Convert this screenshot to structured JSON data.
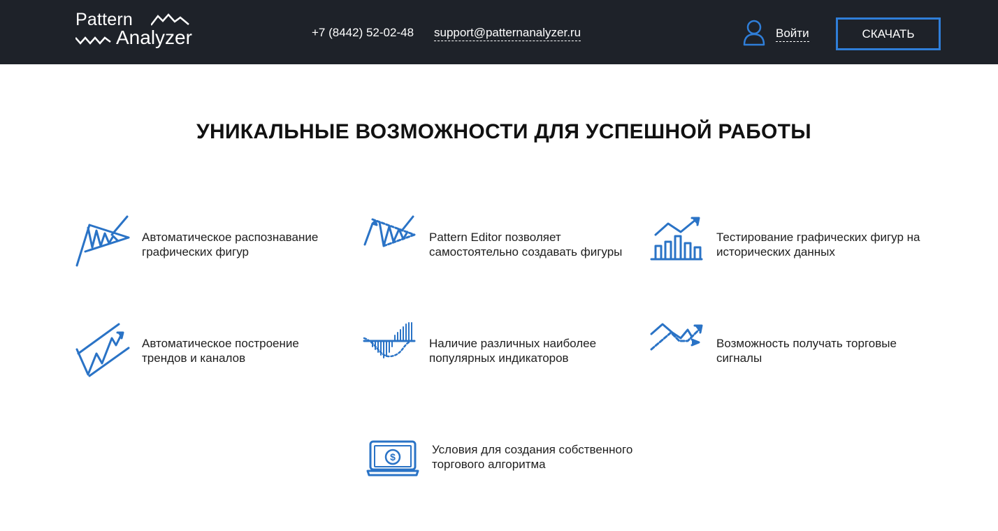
{
  "header": {
    "logo": {
      "line1": "Pattern",
      "line2": "Analyzer"
    },
    "phone": "+7 (8442) 52-02-48",
    "email": "support@patternanalyzer.ru",
    "login_label": "Войти",
    "download_label": "СКАЧАТЬ"
  },
  "main": {
    "title": "УНИКАЛЬНЫЕ ВОЗМОЖНОСТИ ДЛЯ УСПЕШНОЙ РАБОТЫ",
    "features": [
      {
        "icon": "triangle-pattern-icon",
        "line1": "Автоматическое распознавание",
        "line2": "графических фигур"
      },
      {
        "icon": "pattern-editor-icon",
        "line1": "Pattern Editor позволяет",
        "line2": "самостоятельно создавать фигуры"
      },
      {
        "icon": "backtest-chart-icon",
        "line1": "Тестирование графических фигур на",
        "line2": "исторических данных"
      },
      {
        "icon": "trend-channel-icon",
        "line1": "Автоматическое построение",
        "line2": "трендов и каналов"
      },
      {
        "icon": "indicators-icon",
        "line1": "Наличие различных наиболее",
        "line2": "популярных индикаторов"
      },
      {
        "icon": "trade-signals-icon",
        "line1": "Возможность получать торговые",
        "line2": "сигналы"
      },
      {
        "icon": "laptop-dollar-icon",
        "line1": "Условия для создания собственного",
        "line2": "торгового алгоритма"
      }
    ]
  },
  "colors": {
    "header_bg": "#1e2229",
    "accent_blue": "#2f7ed8",
    "icon_blue": "#2a73c6"
  }
}
